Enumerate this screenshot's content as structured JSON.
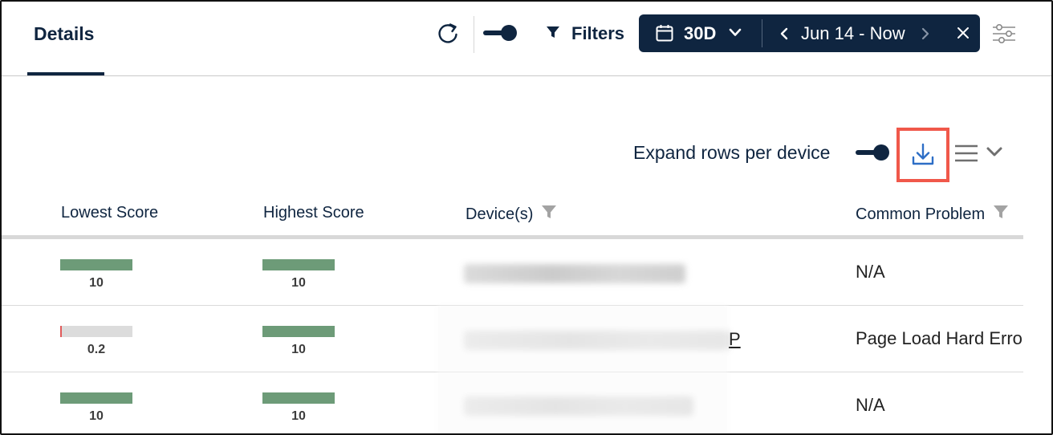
{
  "header": {
    "tab_label": "Details",
    "filters_label": "Filters",
    "date_range_option": "30D",
    "date_label": "Jun 14 - Now",
    "colors": {
      "brand_navy": "#0f2540",
      "accent_red": "#f0584a"
    }
  },
  "toolbar": {
    "expand_label": "Expand rows per device",
    "icons": [
      "download-icon",
      "columns-menu-icon",
      "chevron-down-icon"
    ]
  },
  "table": {
    "columns": [
      "Lowest Score",
      "Highest Score",
      "Device(s)",
      "Common Problem"
    ],
    "rows": [
      {
        "lowest": "10",
        "lowest_fraction": 1.0,
        "highest": "10",
        "highest_fraction": 1.0,
        "device": "",
        "problem": "N/A"
      },
      {
        "lowest": "0.2",
        "lowest_fraction": 0.02,
        "highest": "10",
        "highest_fraction": 1.0,
        "device": "P",
        "problem": "Page Load Hard Erro"
      },
      {
        "lowest": "10",
        "lowest_fraction": 1.0,
        "highest": "10",
        "highest_fraction": 1.0,
        "device": "",
        "problem": "N/A"
      }
    ],
    "colors": {
      "score_good": "#6d9b78",
      "score_bad": "#e05a5a"
    }
  }
}
